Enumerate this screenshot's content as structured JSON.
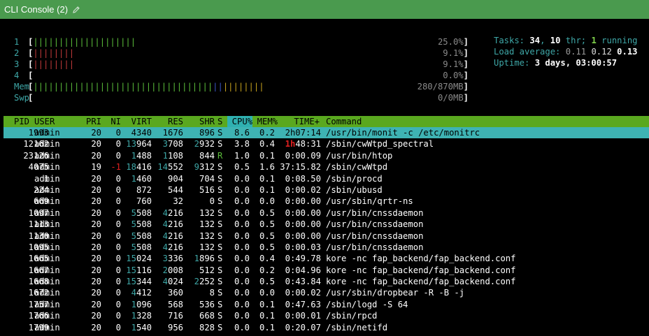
{
  "window": {
    "title": "CLI Console (2)",
    "edit_icon": "pencil-icon"
  },
  "meters": [
    {
      "label": "1",
      "bar": [
        {
          "c": "g",
          "t": "||||||||||||||||||||"
        }
      ],
      "pct": "25.0%"
    },
    {
      "label": "2",
      "bar": [
        {
          "c": "r",
          "t": "||||||||"
        }
      ],
      "pct": "9.1%"
    },
    {
      "label": "3",
      "bar": [
        {
          "c": "r",
          "t": "||||||||"
        }
      ],
      "pct": "9.1%"
    },
    {
      "label": "4",
      "bar": [],
      "pct": "0.0%"
    },
    {
      "label": "Mem",
      "bar": [
        {
          "c": "g",
          "t": "|||||||||||||||||||||||||||||||||||"
        },
        {
          "c": "b",
          "t": "||"
        },
        {
          "c": "y",
          "t": "||||||||"
        }
      ],
      "pct": "280/870MB"
    },
    {
      "label": "Swp",
      "bar": [],
      "pct": "0/0MB"
    }
  ],
  "stats": {
    "tasks_label": "Tasks: ",
    "tasks": "34",
    "sep1": ", ",
    "thr": "10",
    "thr_label": " thr; ",
    "running": "1",
    "running_label": " running",
    "load_label": "Load average: ",
    "load1": "0.11",
    "load5": "0.12",
    "load15": "0.13",
    "uptime_label": "Uptime: ",
    "uptime": "3 days, 03:00:57"
  },
  "columns": [
    "PID",
    "USER",
    "PRI",
    "NI",
    "VIRT",
    "RES",
    "SHR",
    "S",
    "CPU%",
    "MEM%",
    "TIME+",
    "Command"
  ],
  "processes": [
    {
      "pid": "1993",
      "user": "admin",
      "pri": "20",
      "ni": "0",
      "virt": [
        "",
        "4340"
      ],
      "res": [
        "",
        "1676"
      ],
      "shr": [
        "",
        "896"
      ],
      "s": "S",
      "cpu": "8.6",
      "mem": "0.2",
      "time": [
        "",
        "2h07:14"
      ],
      "cmd": "/usr/bin/monit -c /etc/monitrc",
      "selected": true
    },
    {
      "pid": "12162",
      "user": "admin",
      "pri": "20",
      "ni": "0",
      "virt": [
        "13",
        "964"
      ],
      "res": [
        "3",
        "708"
      ],
      "shr": [
        "2",
        "932"
      ],
      "s": "S",
      "cpu": "3.8",
      "mem": "0.4",
      "time": [
        "1h",
        "48:31"
      ],
      "cmd": "/sbin/cwWtpd_spectral"
    },
    {
      "pid": "23126",
      "user": "admin",
      "pri": "20",
      "ni": "0",
      "virt": [
        "1",
        "488"
      ],
      "res": [
        "1",
        "108"
      ],
      "shr": [
        "",
        "844"
      ],
      "s": "R",
      "cpu": "1.0",
      "mem": "0.1",
      "time": [
        "",
        "0:00.09"
      ],
      "cmd": "/usr/bin/htop"
    },
    {
      "pid": "4075",
      "user": "admin",
      "pri": "19",
      "ni": "-1",
      "virt": [
        "18",
        "416"
      ],
      "res": [
        "14",
        "552"
      ],
      "shr": [
        "9",
        "312"
      ],
      "s": "S",
      "cpu": "0.5",
      "mem": "1.6",
      "time": [
        "",
        "37:15.82"
      ],
      "cmd": "/sbin/cwWtpd"
    },
    {
      "pid": "1",
      "user": "admin",
      "pri": "20",
      "ni": "0",
      "virt": [
        "1",
        "460"
      ],
      "res": [
        "",
        "904"
      ],
      "shr": [
        "",
        "704"
      ],
      "s": "S",
      "cpu": "0.0",
      "mem": "0.1",
      "time": [
        "",
        "0:08.50"
      ],
      "cmd": "/sbin/procd"
    },
    {
      "pid": "224",
      "user": "admin",
      "pri": "20",
      "ni": "0",
      "virt": [
        "",
        "872"
      ],
      "res": [
        "",
        "544"
      ],
      "shr": [
        "",
        "516"
      ],
      "s": "S",
      "cpu": "0.0",
      "mem": "0.1",
      "time": [
        "",
        "0:00.02"
      ],
      "cmd": "/sbin/ubusd"
    },
    {
      "pid": "669",
      "user": "admin",
      "pri": "20",
      "ni": "0",
      "virt": [
        "",
        "760"
      ],
      "res": [
        "",
        "32"
      ],
      "shr": [
        "",
        "0"
      ],
      "s": "S",
      "cpu": "0.0",
      "mem": "0.0",
      "time": [
        "",
        "0:00.00"
      ],
      "cmd": "/usr/sbin/qrtr-ns"
    },
    {
      "pid": "1097",
      "user": "admin",
      "pri": "20",
      "ni": "0",
      "virt": [
        "5",
        "508"
      ],
      "res": [
        "4",
        "216"
      ],
      "shr": [
        "",
        "132"
      ],
      "s": "S",
      "cpu": "0.0",
      "mem": "0.5",
      "time": [
        "",
        "0:00.00"
      ],
      "cmd": "/usr/bin/cnssdaemon"
    },
    {
      "pid": "1113",
      "user": "admin",
      "pri": "20",
      "ni": "0",
      "virt": [
        "5",
        "508"
      ],
      "res": [
        "4",
        "216"
      ],
      "shr": [
        "",
        "132"
      ],
      "s": "S",
      "cpu": "0.0",
      "mem": "0.5",
      "time": [
        "",
        "0:00.00"
      ],
      "cmd": "/usr/bin/cnssdaemon"
    },
    {
      "pid": "1130",
      "user": "admin",
      "pri": "20",
      "ni": "0",
      "virt": [
        "5",
        "508"
      ],
      "res": [
        "4",
        "216"
      ],
      "shr": [
        "",
        "132"
      ],
      "s": "S",
      "cpu": "0.0",
      "mem": "0.5",
      "time": [
        "",
        "0:00.00"
      ],
      "cmd": "/usr/bin/cnssdaemon"
    },
    {
      "pid": "1095",
      "user": "admin",
      "pri": "20",
      "ni": "0",
      "virt": [
        "5",
        "508"
      ],
      "res": [
        "4",
        "216"
      ],
      "shr": [
        "",
        "132"
      ],
      "s": "S",
      "cpu": "0.0",
      "mem": "0.5",
      "time": [
        "",
        "0:00.03"
      ],
      "cmd": "/usr/bin/cnssdaemon"
    },
    {
      "pid": "1665",
      "user": "admin",
      "pri": "20",
      "ni": "0",
      "virt": [
        "15",
        "024"
      ],
      "res": [
        "3",
        "336"
      ],
      "shr": [
        "1",
        "896"
      ],
      "s": "S",
      "cpu": "0.0",
      "mem": "0.4",
      "time": [
        "",
        "0:49.78"
      ],
      "cmd": "kore -nc fap_backend/fap_backend.conf"
    },
    {
      "pid": "1667",
      "user": "admin",
      "pri": "20",
      "ni": "0",
      "virt": [
        "15",
        "116"
      ],
      "res": [
        "2",
        "008"
      ],
      "shr": [
        "",
        "512"
      ],
      "s": "S",
      "cpu": "0.0",
      "mem": "0.2",
      "time": [
        "",
        "0:04.96"
      ],
      "cmd": "kore -nc fap_backend/fap_backend.conf"
    },
    {
      "pid": "1668",
      "user": "admin",
      "pri": "20",
      "ni": "0",
      "virt": [
        "15",
        "344"
      ],
      "res": [
        "4",
        "024"
      ],
      "shr": [
        "2",
        "252"
      ],
      "s": "S",
      "cpu": "0.0",
      "mem": "0.5",
      "time": [
        "",
        "0:43.84"
      ],
      "cmd": "kore -nc fap_backend/fap_backend.conf"
    },
    {
      "pid": "1672",
      "user": "admin",
      "pri": "20",
      "ni": "0",
      "virt": [
        "4",
        "412"
      ],
      "res": [
        "",
        "360"
      ],
      "shr": [
        "",
        "8"
      ],
      "s": "S",
      "cpu": "0.0",
      "mem": "0.0",
      "time": [
        "",
        "0:00.02"
      ],
      "cmd": "/usr/sbin/dropbear -R -B -j"
    },
    {
      "pid": "1757",
      "user": "admin",
      "pri": "20",
      "ni": "0",
      "virt": [
        "1",
        "096"
      ],
      "res": [
        "",
        "568"
      ],
      "shr": [
        "",
        "536"
      ],
      "s": "S",
      "cpu": "0.0",
      "mem": "0.1",
      "time": [
        "",
        "0:47.63"
      ],
      "cmd": "/sbin/logd -S 64"
    },
    {
      "pid": "1766",
      "user": "admin",
      "pri": "20",
      "ni": "0",
      "virt": [
        "1",
        "328"
      ],
      "res": [
        "",
        "716"
      ],
      "shr": [
        "",
        "668"
      ],
      "s": "S",
      "cpu": "0.0",
      "mem": "0.1",
      "time": [
        "",
        "0:00.01"
      ],
      "cmd": "/sbin/rpcd"
    },
    {
      "pid": "1799",
      "user": "admin",
      "pri": "20",
      "ni": "0",
      "virt": [
        "1",
        "540"
      ],
      "res": [
        "",
        "956"
      ],
      "shr": [
        "",
        "828"
      ],
      "s": "S",
      "cpu": "0.0",
      "mem": "0.1",
      "time": [
        "",
        "0:20.07"
      ],
      "cmd": "/sbin/netifd"
    }
  ]
}
